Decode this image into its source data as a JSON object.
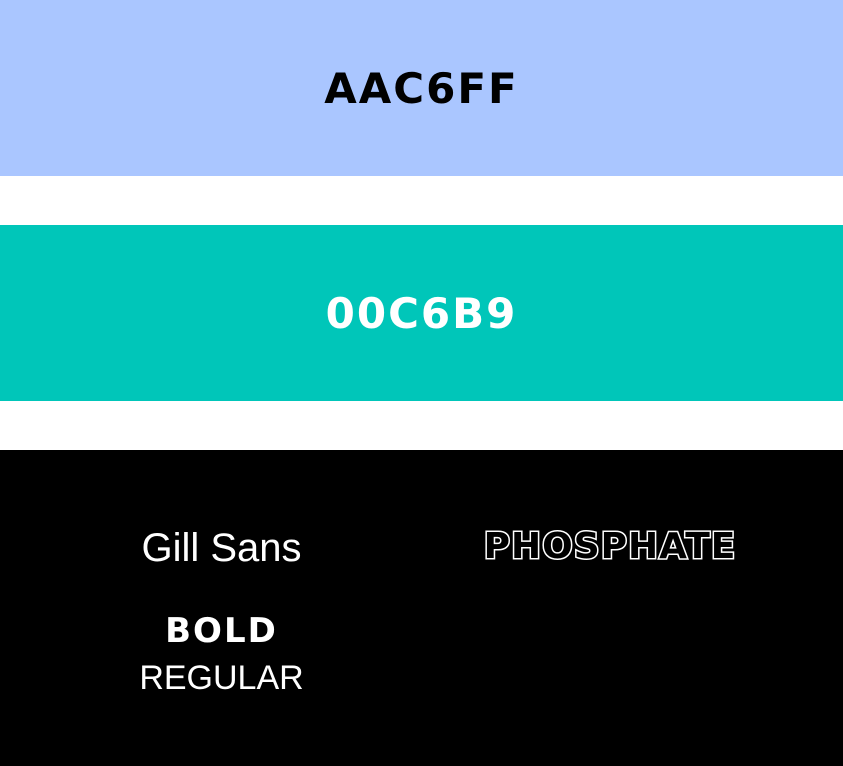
{
  "swatches": [
    {
      "label": "AAC6FF",
      "color": "#AAC6FF",
      "text_color": "#000000"
    },
    {
      "label": "00C6B9",
      "color": "#00C6B9",
      "text_color": "#FFFFFF"
    }
  ],
  "fonts_panel": {
    "background": "#000000",
    "primary_font": {
      "name": "Gill Sans",
      "weights": [
        "BOLD",
        "REGULAR"
      ]
    },
    "secondary_font": {
      "name": "PHOSPHATE"
    }
  }
}
